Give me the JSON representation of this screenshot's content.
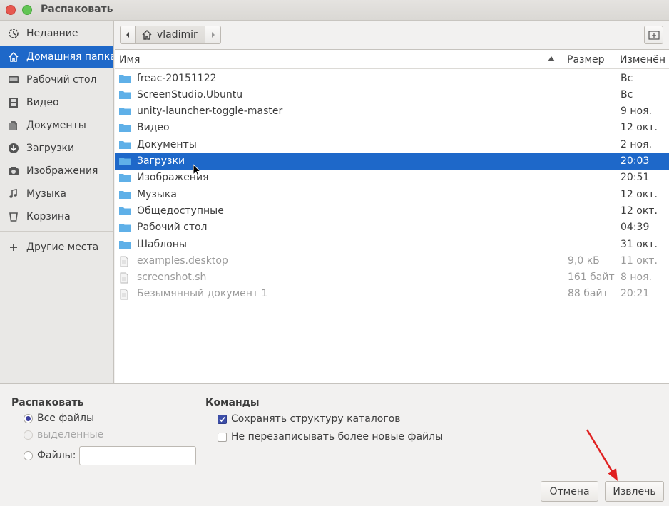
{
  "window": {
    "title": "Распаковать"
  },
  "sidebar": {
    "items": [
      {
        "label": "Недавние",
        "icon": "recent-icon"
      },
      {
        "label": "Домашняя папка",
        "icon": "home-icon",
        "active": true
      },
      {
        "label": "Рабочий стол",
        "icon": "desktop-icon"
      },
      {
        "label": "Видео",
        "icon": "video-icon"
      },
      {
        "label": "Документы",
        "icon": "documents-icon"
      },
      {
        "label": "Загрузки",
        "icon": "downloads-icon"
      },
      {
        "label": "Изображения",
        "icon": "camera-icon"
      },
      {
        "label": "Музыка",
        "icon": "music-icon"
      },
      {
        "label": "Корзина",
        "icon": "trash-icon"
      }
    ],
    "other": {
      "label": "Другие места",
      "icon": "plus-icon"
    }
  },
  "pathbar": {
    "current": "vladimir"
  },
  "filelist": {
    "columns": {
      "name": "Имя",
      "size": "Размер",
      "modified": "Изменён"
    },
    "rows": [
      {
        "name": "freac-20151122",
        "size": "",
        "modified": "Вс",
        "type": "folder"
      },
      {
        "name": "ScreenStudio.Ubuntu",
        "size": "",
        "modified": "Вс",
        "type": "folder"
      },
      {
        "name": "unity-launcher-toggle-master",
        "size": "",
        "modified": "9 ноя.",
        "type": "folder"
      },
      {
        "name": "Видео",
        "size": "",
        "modified": "12 окт.",
        "type": "folder"
      },
      {
        "name": "Документы",
        "size": "",
        "modified": "2 ноя.",
        "type": "folder"
      },
      {
        "name": "Загрузки",
        "size": "",
        "modified": "20:03",
        "type": "folder",
        "selected": true
      },
      {
        "name": "Изображения",
        "size": "",
        "modified": "20:51",
        "type": "folder"
      },
      {
        "name": "Музыка",
        "size": "",
        "modified": "12 окт.",
        "type": "folder"
      },
      {
        "name": "Общедоступные",
        "size": "",
        "modified": "12 окт.",
        "type": "folder"
      },
      {
        "name": "Рабочий стол",
        "size": "",
        "modified": "04:39",
        "type": "folder"
      },
      {
        "name": "Шаблоны",
        "size": "",
        "modified": "31 окт.",
        "type": "folder"
      },
      {
        "name": "examples.desktop",
        "size": "9,0 кБ",
        "modified": "11 окт.",
        "type": "file"
      },
      {
        "name": "screenshot.sh",
        "size": "161 байт",
        "modified": "8 ноя.",
        "type": "file"
      },
      {
        "name": "Безымянный документ 1",
        "size": "88 байт",
        "modified": "20:21",
        "type": "file"
      }
    ]
  },
  "extract": {
    "title": "Распаковать",
    "all_files": "Все файлы",
    "selected": "выделенные",
    "files_label": "Файлы:",
    "files_value": ""
  },
  "commands": {
    "title": "Команды",
    "keep_structure": "Сохранять структуру каталогов",
    "no_overwrite": "Не перезаписывать более новые файлы"
  },
  "buttons": {
    "cancel": "Отмена",
    "extract": "Извлечь"
  },
  "colors": {
    "accent": "#1e68c9",
    "folder": "#5fb0e8",
    "arrow": "#e02020"
  }
}
